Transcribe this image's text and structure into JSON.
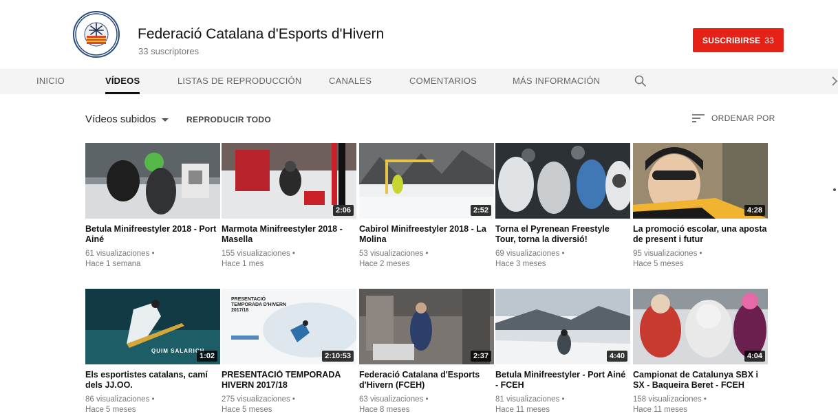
{
  "channel": {
    "title": "Federació Catalana d'Esports d'Hivern",
    "subscribers": "33 suscriptores",
    "logo_text": "FEDERACIÓ CATALANA D'ESPORTS D'HIVERN",
    "subscribe_label": "SUSCRIBIRSE",
    "subscribe_count": "33",
    "subscribe_color": "#e62117"
  },
  "tabs": [
    {
      "label": "INICIO",
      "active": false
    },
    {
      "label": "VÍDEOS",
      "active": true
    },
    {
      "label": "LISTAS DE REPRODUCCIÓN",
      "active": false
    },
    {
      "label": "CANALES",
      "active": false
    },
    {
      "label": "COMENTARIOS",
      "active": false
    },
    {
      "label": "MÁS INFORMACIÓN",
      "active": false
    }
  ],
  "icons": {
    "search": "search-icon",
    "next": "chevron-right-icon",
    "sort": "sort-icon",
    "caret": "caret-down-icon"
  },
  "section": {
    "title": "Vídeos subidos",
    "play_all": "REPRODUCIR TODO",
    "sort_label": "ORDENAR POR"
  },
  "videos": [
    {
      "title": "Betula Minifreestyler 2018 - Port Ainé",
      "views": "61 visualizaciones •",
      "age": "Hace 1 semana",
      "duration": ""
    },
    {
      "title": "Marmota Minifreestyler 2018 - Masella",
      "views": "155 visualizaciones •",
      "age": "Hace 1 mes",
      "duration": "2:06"
    },
    {
      "title": "Cabirol Minifreestyler 2018 - La Molina",
      "views": "53 visualizaciones •",
      "age": "Hace 2 meses",
      "duration": "2:52"
    },
    {
      "title": "Torna el Pyrenean Freestyle Tour, torna la diversió!",
      "views": "69 visualizaciones •",
      "age": "Hace 3 meses",
      "duration": ""
    },
    {
      "title": "La promoció escolar, una aposta de present i futur",
      "views": "95 visualizaciones •",
      "age": "Hace 5 meses",
      "duration": "4:28"
    },
    {
      "title": "Els esportistes catalans, camí dels JJ.OO.",
      "views": "86 visualizaciones •",
      "age": "Hace 5 meses",
      "duration": "1:02"
    },
    {
      "title": "PRESENTACIÓ TEMPORADA HIVERN 2017/18",
      "views": "275 visualizaciones •",
      "age": "Hace 5 meses",
      "duration": "2:10:53"
    },
    {
      "title": "Federació Catalana d'Esports d'Hivern (FCEH)",
      "views": "63 visualizaciones •",
      "age": "Hace 8 meses",
      "duration": "2:37"
    },
    {
      "title": "Betula Minifreestyler - Port Ainé - FCEH",
      "views": "81 visualizaciones •",
      "age": "Hace 11 meses",
      "duration": "4:40"
    },
    {
      "title": "Campionat de Catalunya SBX i SX - Baqueira Beret - FCEH",
      "views": "158 visualizaciones •",
      "age": "Hace 11 meses",
      "duration": "4:04"
    }
  ],
  "thumb_texts": {
    "presentacio": "PRESENTACIÓ TEMPORADA D'HIVERN 2017/18",
    "jjoo": "QUIM SALARICH"
  }
}
